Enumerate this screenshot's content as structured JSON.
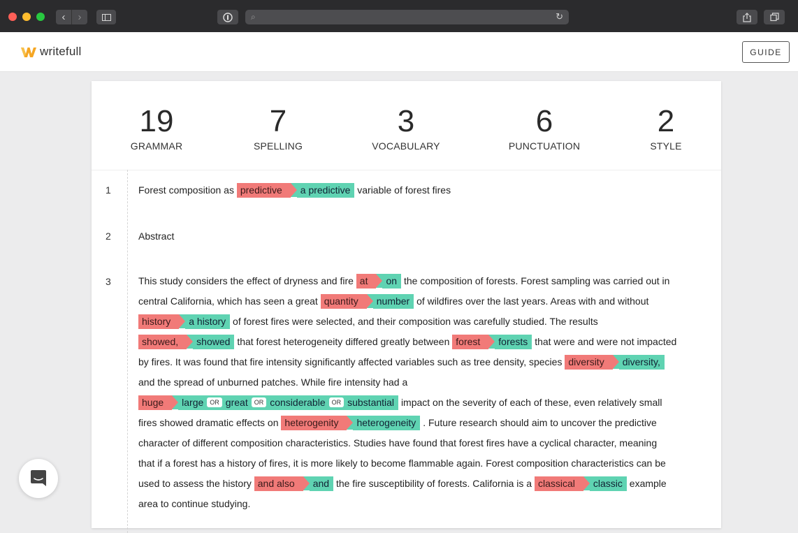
{
  "brand": {
    "name": "writefull",
    "color": "#f5a623"
  },
  "header": {
    "guide_label": "GUIDE"
  },
  "colors": {
    "delete": "#f17a78",
    "insert": "#5fd3b2"
  },
  "stats": [
    {
      "count": "19",
      "label": "GRAMMAR"
    },
    {
      "count": "7",
      "label": "SPELLING"
    },
    {
      "count": "3",
      "label": "VOCABULARY"
    },
    {
      "count": "6",
      "label": "PUNCTUATION"
    },
    {
      "count": "2",
      "label": "STYLE"
    }
  ],
  "lines": [
    {
      "number": "1",
      "pre": "Forest composition as",
      "sug_del": "predictive",
      "sug_ins": "a predictive",
      "post": "variable of forest fires"
    },
    {
      "number": "2",
      "text": "Abstract"
    },
    {
      "number": "3",
      "rows": [
        {
          "t1": "This study considers the effect of dryness and fire",
          "d1": "at",
          "i1": "on",
          "t2": "the composition of forests. Forest sampling was carried out in"
        },
        {
          "t1": "central California, which has seen a great",
          "d1": "quantity",
          "i1": "number",
          "t2": "of wildfires over the last years. Areas with and without"
        },
        {
          "d1": "history",
          "i1": "a history",
          "t2": "of forest fires were selected, and their composition was carefully studied. The results"
        },
        {
          "d1": "showed,",
          "i1": "showed",
          "t2": "that forest heterogeneity differed greatly between",
          "d2": "forest",
          "i2": "forests",
          "t3": "that were and were not impacted"
        },
        {
          "t1": "by fires. It was found that fire intensity significantly affected variables such as tree density, species",
          "d1": "diversity",
          "i1": "diversity,"
        },
        {
          "t1": "and the spread of unburned patches. While fire intensity had a"
        },
        {
          "d1": "huge",
          "alts": [
            "large",
            "great",
            "considerable",
            "substantial"
          ],
          "or_label": "OR",
          "t2": "impact on the severity of each of these, even relatively small"
        },
        {
          "t1": "fires showed dramatic effects on",
          "d1": "heterogenity",
          "i1": "heterogeneity",
          "t2": ". Future research should aim to uncover the predictive"
        },
        {
          "t1": "character of different composition characteristics. Studies have found that forest fires have a cyclical character, meaning"
        },
        {
          "t1": "that if a forest has a history of fires, it is more likely to become flammable again. Forest composition characteristics can be"
        },
        {
          "t1": "used to assess the history",
          "d1": "and also",
          "i1": "and",
          "t2": "the fire susceptibility of forests. California is a",
          "d2": "classical",
          "i2": "classic",
          "t3": "example"
        },
        {
          "t1": "area to continue studying."
        }
      ]
    }
  ]
}
